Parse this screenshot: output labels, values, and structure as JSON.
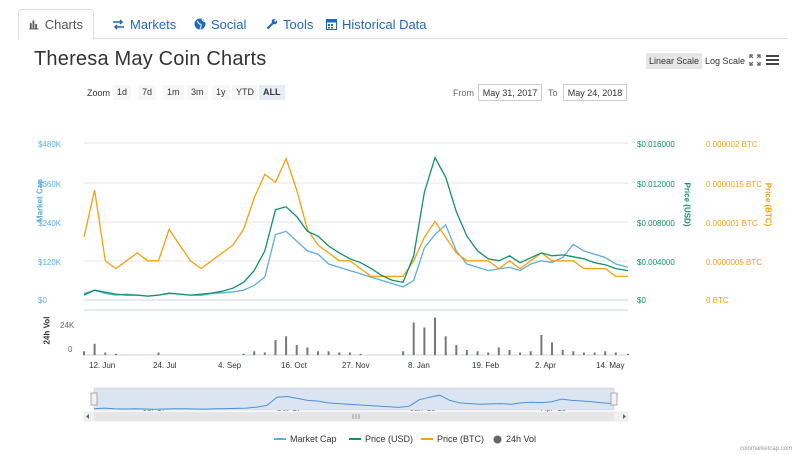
{
  "tabs": [
    {
      "label": "Charts",
      "icon": "bar-chart-icon",
      "active": true
    },
    {
      "label": "Markets",
      "icon": "exchange-icon",
      "active": false
    },
    {
      "label": "Social",
      "icon": "globe-icon",
      "active": false
    },
    {
      "label": "Tools",
      "icon": "wrench-icon",
      "active": false
    },
    {
      "label": "Historical Data",
      "icon": "calendar-icon",
      "active": false
    }
  ],
  "title": "Theresa May Coin Charts",
  "scale": {
    "linear": "Linear Scale",
    "log": "Log Scale",
    "active": "linear"
  },
  "zoom": {
    "label": "Zoom",
    "buttons": [
      "1d",
      "7d",
      "1m",
      "3m",
      "1y",
      "YTD",
      "ALL"
    ],
    "active": "ALL"
  },
  "range": {
    "from_label": "From",
    "from": "May 31, 2017",
    "to_label": "To",
    "to": "May 24, 2018"
  },
  "axes": {
    "market_cap_title": "Market Cap",
    "market_cap_ticks": [
      "$480K",
      "$360K",
      "$240K",
      "$120K",
      "$0"
    ],
    "price_usd_title": "Price (USD)",
    "price_usd_ticks": [
      "$0.016000",
      "$0.012000",
      "$0.008000",
      "$0.004000",
      "$0"
    ],
    "price_btc_title": "Price (BTC)",
    "price_btc_ticks": [
      "0.000002 BTC",
      "0.0000015 BTC",
      "0.000001 BTC",
      "0.0000005 BTC",
      "0 BTC"
    ],
    "volume_title": "24h Vol",
    "volume_ticks": [
      "24K",
      "0"
    ],
    "x_ticks": [
      "12. Jun",
      "24. Jul",
      "4. Sep",
      "16. Oct",
      "27. Nov",
      "8. Jan",
      "19. Feb",
      "2. Apr",
      "14. May"
    ],
    "navigator_ticks": [
      "Jul '17",
      "Oct '17",
      "Jan '18",
      "Apr '18"
    ]
  },
  "legend": [
    {
      "label": "Market Cap",
      "color": "#5daee0"
    },
    {
      "label": "Price (USD)",
      "color": "#11916b"
    },
    {
      "label": "Price (BTC)",
      "color": "#f7a00d"
    },
    {
      "label": "24h Vol",
      "color": "#666666"
    }
  ],
  "colors": {
    "market_cap": "#5daee0",
    "price_usd": "#11916b",
    "price_btc": "#f7a00d",
    "volume": "#777777"
  },
  "credit": "coinmarketcap.com",
  "chart_data": {
    "type": "line",
    "x": [
      "2017-05-31",
      "2017-06-07",
      "2017-06-14",
      "2017-06-21",
      "2017-06-28",
      "2017-07-05",
      "2017-07-12",
      "2017-07-19",
      "2017-07-26",
      "2017-08-02",
      "2017-08-09",
      "2017-08-16",
      "2017-08-23",
      "2017-08-30",
      "2017-09-06",
      "2017-09-13",
      "2017-09-20",
      "2017-09-27",
      "2017-10-04",
      "2017-10-11",
      "2017-10-18",
      "2017-10-25",
      "2017-11-01",
      "2017-11-08",
      "2017-11-15",
      "2017-11-22",
      "2017-11-29",
      "2017-12-06",
      "2017-12-13",
      "2017-12-20",
      "2017-12-27",
      "2018-01-03",
      "2018-01-10",
      "2018-01-17",
      "2018-01-24",
      "2018-01-31",
      "2018-02-07",
      "2018-02-14",
      "2018-02-21",
      "2018-02-28",
      "2018-03-07",
      "2018-03-14",
      "2018-03-21",
      "2018-03-28",
      "2018-04-04",
      "2018-04-11",
      "2018-04-18",
      "2018-04-25",
      "2018-05-02",
      "2018-05-09",
      "2018-05-16",
      "2018-05-24"
    ],
    "series": [
      {
        "name": "Market Cap",
        "axis": "market_cap",
        "values": [
          20000,
          30000,
          20000,
          15000,
          18000,
          15000,
          12000,
          15000,
          20000,
          18000,
          15000,
          14000,
          20000,
          22000,
          25000,
          30000,
          45000,
          70000,
          200000,
          210000,
          180000,
          150000,
          140000,
          110000,
          100000,
          90000,
          80000,
          70000,
          60000,
          50000,
          40000,
          60000,
          160000,
          200000,
          230000,
          150000,
          110000,
          100000,
          90000,
          95000,
          100000,
          90000,
          110000,
          120000,
          115000,
          130000,
          170000,
          150000,
          140000,
          130000,
          110000,
          100000
        ]
      },
      {
        "name": "Price (USD)",
        "axis": "price_usd",
        "values": [
          0.0005,
          0.001,
          0.0008,
          0.0006,
          0.0005,
          0.0005,
          0.0004,
          0.0005,
          0.0007,
          0.0006,
          0.0005,
          0.0006,
          0.0007,
          0.0009,
          0.0012,
          0.0018,
          0.003,
          0.005,
          0.0092,
          0.0095,
          0.0085,
          0.007,
          0.0065,
          0.0055,
          0.0048,
          0.0042,
          0.0038,
          0.0032,
          0.0025,
          0.002,
          0.0018,
          0.0045,
          0.011,
          0.0145,
          0.0125,
          0.009,
          0.0065,
          0.005,
          0.0042,
          0.004,
          0.0045,
          0.0038,
          0.0043,
          0.0048,
          0.0045,
          0.0046,
          0.0044,
          0.0042,
          0.0038,
          0.0036,
          0.0032,
          0.003
        ]
      },
      {
        "name": "Price (BTC)",
        "axis": "price_btc",
        "values": [
          8e-07,
          1.4e-06,
          5e-07,
          4e-07,
          5e-07,
          6e-07,
          5e-07,
          5e-07,
          9e-07,
          7e-07,
          5e-07,
          4e-07,
          5e-07,
          6e-07,
          7e-07,
          9e-07,
          1.3e-06,
          1.6e-06,
          1.5e-06,
          1.8e-06,
          1.4e-06,
          9e-07,
          7e-07,
          6e-07,
          5e-07,
          5e-07,
          4e-07,
          3e-07,
          3e-07,
          3e-07,
          3e-07,
          5e-07,
          8e-07,
          1e-06,
          8e-07,
          6e-07,
          5e-07,
          5e-07,
          5e-07,
          4e-07,
          5e-07,
          4e-07,
          5e-07,
          6e-07,
          5e-07,
          5e-07,
          5e-07,
          4e-07,
          4e-07,
          4e-07,
          3e-07,
          3e-07
        ]
      },
      {
        "name": "24h Vol",
        "axis": "volume",
        "values": [
          3000,
          9000,
          2000,
          1000,
          0,
          0,
          0,
          2000,
          0,
          0,
          0,
          0,
          0,
          0,
          0,
          1000,
          3000,
          2000,
          12000,
          15000,
          8000,
          6000,
          3000,
          3000,
          2000,
          2000,
          1000,
          0,
          0,
          0,
          3000,
          26000,
          22000,
          30000,
          15000,
          8000,
          4000,
          3000,
          2000,
          6000,
          4000,
          2000,
          3000,
          16000,
          10000,
          4000,
          3000,
          2000,
          2000,
          3000,
          2000,
          1000
        ]
      }
    ],
    "ylim": {
      "market_cap": [
        0,
        480000
      ],
      "price_usd": [
        0,
        0.016
      ],
      "price_btc": [
        0,
        2e-06
      ],
      "volume": [
        0,
        36000
      ]
    }
  }
}
